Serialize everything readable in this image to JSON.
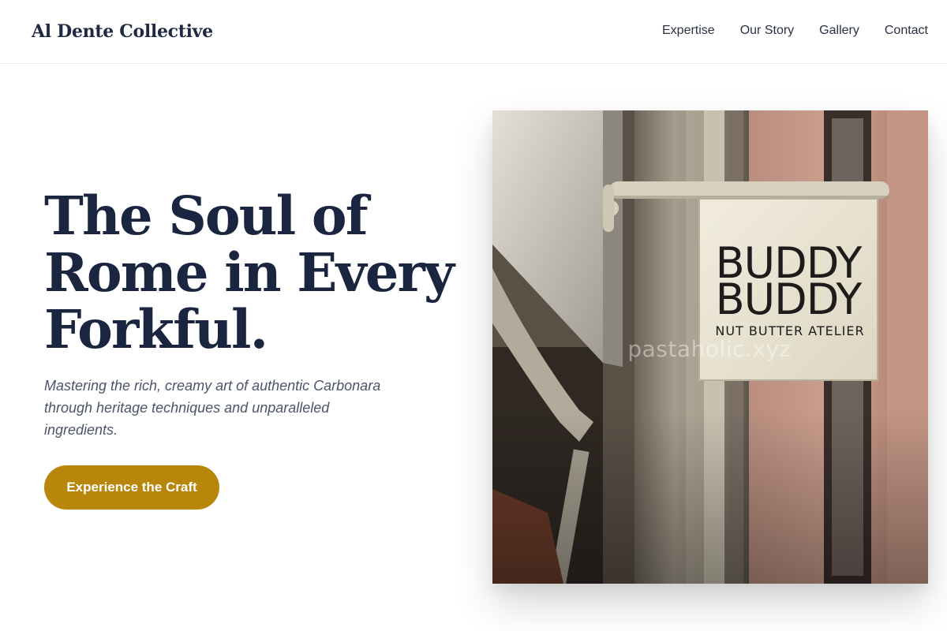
{
  "header": {
    "brand": "Al Dente Collective",
    "nav": [
      {
        "label": "Expertise"
      },
      {
        "label": "Our Story"
      },
      {
        "label": "Gallery"
      },
      {
        "label": "Contact"
      }
    ]
  },
  "hero": {
    "title_lines": [
      "The Soul of",
      "Rome in Every",
      "Forkful."
    ],
    "subtitle_lines": [
      "Mastering the rich, creamy art of authentic Carbonara",
      "through heritage techniques and unparalleled",
      "ingredients."
    ],
    "cta_label": "Experience the Craft",
    "accent_color": "#b8860b",
    "title_color": "#1a2540"
  },
  "image": {
    "sign_line_1": "BUDDY",
    "sign_line_2": "BUDDY",
    "sign_subline": "NUT BUTTER ATELIER",
    "watermark": "pastaholic.xyz"
  }
}
